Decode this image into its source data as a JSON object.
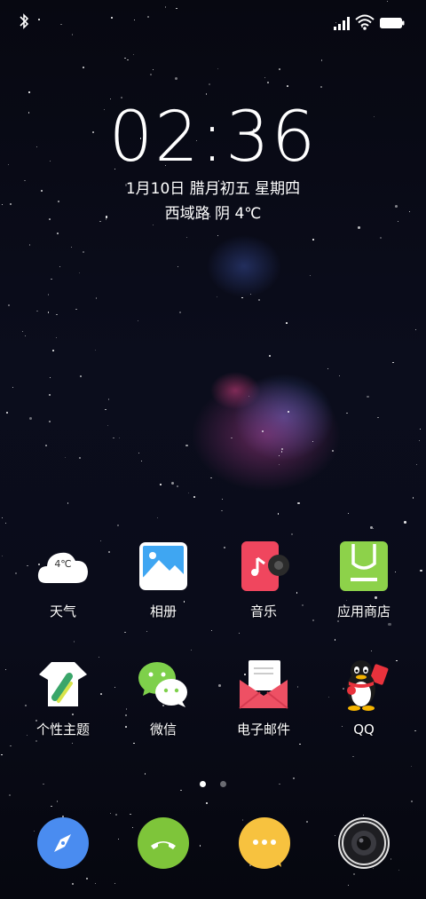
{
  "status_bar": {
    "left_icon": "bluetooth-icon",
    "right_icons": [
      "signal-icon",
      "wifi-icon",
      "battery-icon"
    ]
  },
  "lockscreen": {
    "time": "02:36",
    "date": "1月10日  腊月初五  星期四",
    "weather": "西域路  阴  4℃"
  },
  "apps_row1": [
    {
      "label": "天气",
      "icon": "weather-icon",
      "temp": "4℃"
    },
    {
      "label": "相册",
      "icon": "gallery-icon"
    },
    {
      "label": "音乐",
      "icon": "music-icon"
    },
    {
      "label": "应用商店",
      "icon": "app-store-icon"
    }
  ],
  "apps_row2": [
    {
      "label": "个性主题",
      "icon": "themes-icon"
    },
    {
      "label": "微信",
      "icon": "wechat-icon"
    },
    {
      "label": "电子邮件",
      "icon": "email-icon"
    },
    {
      "label": "QQ",
      "icon": "qq-icon"
    }
  ],
  "page_indicator": {
    "pages": 2,
    "current": 1
  },
  "dock": [
    {
      "icon": "browser-icon",
      "color": "#4a8cf0"
    },
    {
      "icon": "phone-icon",
      "color": "#7ec53a"
    },
    {
      "icon": "messages-icon",
      "color": "#f7c23f"
    },
    {
      "icon": "camera-icon",
      "color": "#2a2a2e"
    }
  ],
  "colors": {
    "music": "#f0465e",
    "app_store": "#8dd24a",
    "email": "#ee5064",
    "wechat": "#7ed04b"
  }
}
